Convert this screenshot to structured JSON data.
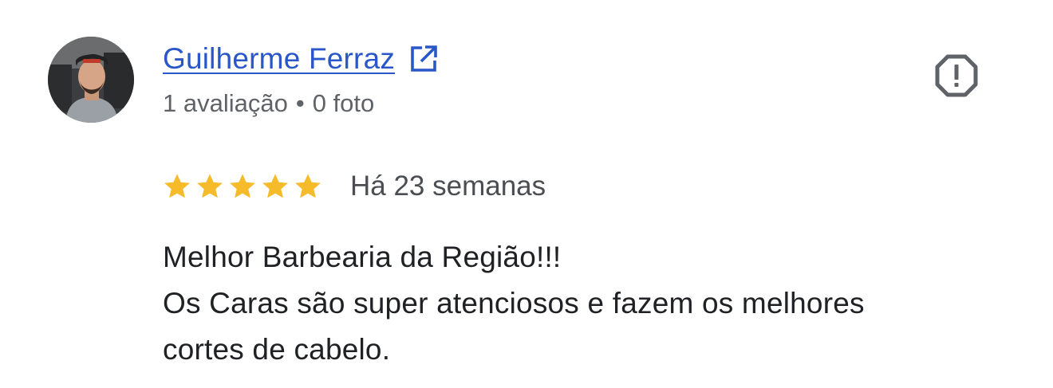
{
  "review": {
    "author_name": "Guilherme Ferraz",
    "author_meta": {
      "reviews": "1 avaliação",
      "separator": "•",
      "photos": "0 foto"
    },
    "rating": 5,
    "rating_max": 5,
    "time_ago": "Há 23 semanas",
    "text_lines": [
      "Melhor Barbearia da Região!!!",
      "Os Caras são super atenciosos e fazem os melhores",
      "cortes de cabelo."
    ]
  },
  "icons": {
    "external_link": "open-in-new-icon",
    "report": "report-flag-icon",
    "star": "star-icon"
  },
  "colors": {
    "link": "#2a57c8",
    "star": "#f6bb2a",
    "muted_text": "#5f6368",
    "body_text": "#202124",
    "report_icon": "#5f6368"
  }
}
